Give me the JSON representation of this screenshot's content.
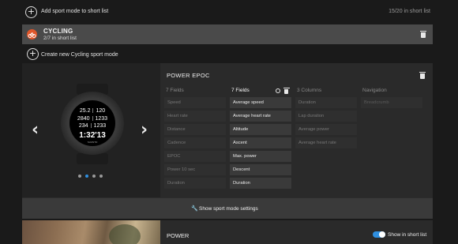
{
  "header": {
    "add_label": "Add sport mode to short list",
    "count": "15/20 in short list"
  },
  "mode": {
    "title": "CYCLING",
    "subtitle": "2/7 in short list",
    "accent_color": "#e0562a"
  },
  "create_label": "Create new Cycling sport mode",
  "watch": {
    "line1": [
      "25.2",
      "120"
    ],
    "line2": [
      "2840",
      "1233"
    ],
    "line3": [
      "234",
      "1233"
    ],
    "time": "1:32'13",
    "brand": "SUUNTO"
  },
  "carousel": {
    "count": 4,
    "active": 1
  },
  "display": {
    "title": "POWER EPOC",
    "columns": [
      {
        "header": "7 Fields",
        "fields": [
          "Speed",
          "Heart rate",
          "Distance",
          "Cadence",
          "EPOC",
          "Power 10 sec",
          "Duration"
        ]
      },
      {
        "header": "7 Fields",
        "fields": [
          "Average speed",
          "Average heart rate",
          "Altitude",
          "Ascent",
          "Max. power",
          "Descent",
          "Duration"
        ]
      },
      {
        "header": "3 Columns",
        "fields": [
          "Duration",
          "Lap duration",
          "Average power",
          "Average heart rate"
        ]
      },
      {
        "header": "Navigation",
        "fields": [
          "Breadcrumb"
        ]
      }
    ]
  },
  "settings_label": "Show sport mode settings",
  "power": {
    "title": "POWER",
    "toggle_label": "Show in short list",
    "toggle_on": true,
    "toggle_color": "#2f8fe0"
  }
}
